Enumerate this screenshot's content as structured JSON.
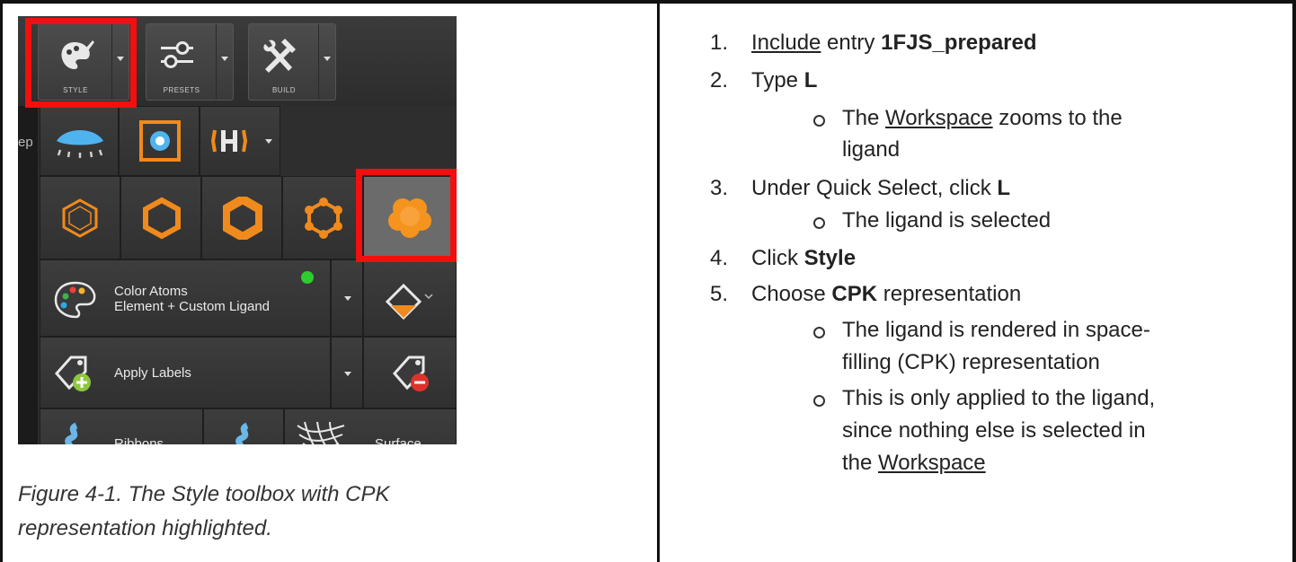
{
  "figure": {
    "toolbar": {
      "style_label": "STYLE",
      "presets_label": "PRESETS",
      "build_label": "BUILD"
    },
    "panel": {
      "color_atoms_line1": "Color Atoms",
      "color_atoms_line2": "Element + Custom Ligand",
      "apply_labels": "Apply Labels",
      "ribbons": "Ribbons",
      "surface": "Surface"
    },
    "background_fragment": "ep",
    "caption_line1": "Figure 4-1. The Style toolbox with CPK",
    "caption_line2": "representation highlighted.",
    "highlight_color": "#f20f0f",
    "accent_color": "#f08a1c"
  },
  "steps": {
    "s1": {
      "num": "1.",
      "link": "Include",
      "text": " entry ",
      "bold": "1FJS_prepared"
    },
    "s2": {
      "num": "2.",
      "text": "Type ",
      "bold": "L"
    },
    "s2_sub1": {
      "pre": "The ",
      "link": "Workspace",
      "post": " zooms to the",
      "cont": "ligand"
    },
    "s3": {
      "num": "3.",
      "text": "Under Quick Select, click ",
      "bold": "L"
    },
    "s3_sub1": "The ligand is selected",
    "s4": {
      "num": "4.",
      "text": "Click ",
      "bold": "Style"
    },
    "s5": {
      "num": "5.",
      "text": "Choose ",
      "bold": "CPK",
      "post": " representation"
    },
    "s5_sub1": {
      "line1": "The ligand is rendered in space-",
      "line2": "filling (CPK) representation"
    },
    "s5_sub2": {
      "line1": "This is only applied to the ligand,",
      "line2": "since nothing else is selected in",
      "pre3": "the ",
      "link3": "Workspace"
    }
  }
}
